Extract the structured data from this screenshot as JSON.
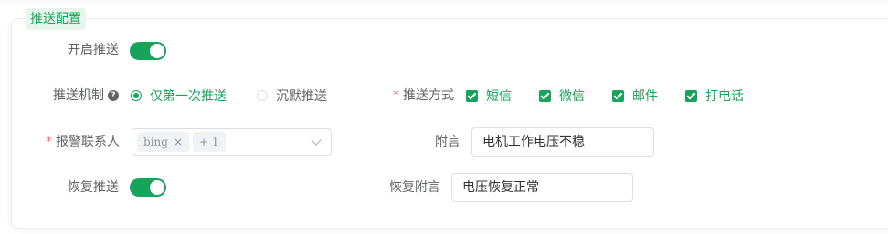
{
  "panel": {
    "title": "推送配置"
  },
  "fields": {
    "enable_push": {
      "label": "开启推送",
      "on": true
    },
    "push_mechanism": {
      "label": "推送机制",
      "options": [
        {
          "label": "仅第一次推送",
          "selected": true
        },
        {
          "label": "沉默推送",
          "selected": false
        }
      ]
    },
    "push_methods": {
      "label": "推送方式",
      "options": [
        {
          "label": "短信",
          "checked": true
        },
        {
          "label": "微信",
          "checked": true
        },
        {
          "label": "邮件",
          "checked": true
        },
        {
          "label": "打电话",
          "checked": true
        }
      ]
    },
    "alarm_contacts": {
      "label": "报警联系人",
      "tags": [
        "bing"
      ],
      "more": "+ 1"
    },
    "remark": {
      "label": "附言",
      "value": "电机工作电压不稳"
    },
    "restore_push": {
      "label": "恢复推送",
      "on": true
    },
    "restore_remark": {
      "label": "恢复附言",
      "value": "电压恢复正常"
    }
  },
  "colors": {
    "primary": "#16a35a",
    "required": "#f56c6c",
    "label": "#606266"
  }
}
